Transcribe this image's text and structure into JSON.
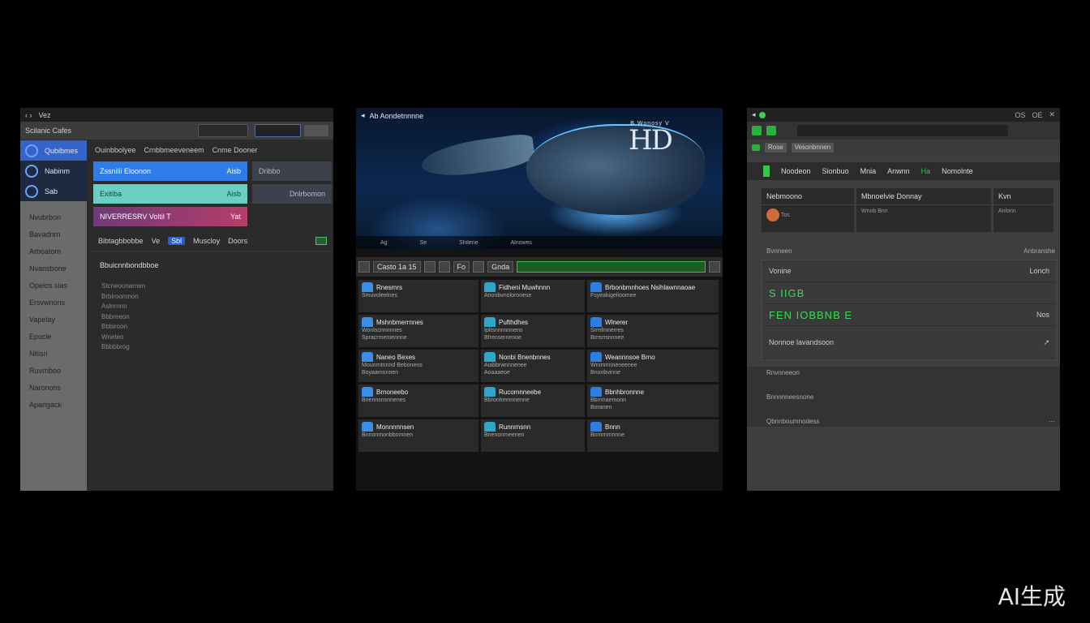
{
  "left": {
    "title": "Vez",
    "toolbar_label": "Scilanic Cafes",
    "side_top": [
      "Qubibmes",
      "Nabinm",
      "Sab"
    ],
    "side_list": [
      "Nvubrbon",
      "Bavadnrn",
      "Arboatom",
      "Nvansbone",
      "Opelos sias",
      "Ersvwnons",
      "Vapelay",
      "Epucle",
      "Nitisn",
      "Ruvrnboo",
      "Naronons",
      "Aparlgack"
    ],
    "tabs": [
      "Ouinbbolyee",
      "Crnbbmeeveneem",
      "Cnme Dooner"
    ],
    "cards": [
      {
        "label": "Zssnilii Eloonon",
        "tag": "Aisb"
      },
      {
        "label": "Dribbo",
        "tag": ""
      },
      {
        "label": "Exitiba",
        "tag": "Aisb"
      },
      {
        "label": "",
        "tag": "Dnlrbomon"
      },
      {
        "label": "NIVERRESRV  Voltil T",
        "tag": "Yat"
      }
    ],
    "subbar": [
      "Bibtagbbobbe",
      "Ve",
      "Sbl",
      "Muscloy",
      "Doors"
    ],
    "section_title": "Bbuicnnbondbboe",
    "bullets": [
      "Stcneoonarnen",
      "Brbiroomnon",
      "Aslnrnnn",
      "Bbbreeon",
      "Bbbiroon",
      "Wneten",
      "Bbbbbrog"
    ]
  },
  "mid": {
    "caption": "Ab  Aondetnnnne",
    "logo_small": "B Wonosy V",
    "logo_big": "HD",
    "bottom_caption": [
      "Ag",
      "Se",
      "Shilene",
      "Alnowes"
    ],
    "controls": [
      "Casto 1a 15",
      "Fo",
      "Gnda"
    ],
    "grid": [
      {
        "head": "Rnesmrs",
        "sub": [
          "Smuvoleelnes"
        ]
      },
      {
        "head": "Fidheni Muwhnnn",
        "sub": [
          "Anonbvnoloronese"
        ]
      },
      {
        "head": "Brbonbmnhoes Nsihlawnnaoae",
        "sub": [
          "Fsyeakigelioomee"
        ]
      },
      {
        "head": "Mshnbmerrnnes",
        "sub": [
          "Wonlscnnnnnes",
          "Spracrmemennne"
        ]
      },
      {
        "head": "Pufthdhes",
        "sub": [
          "Ipltsnnnnnnens",
          "Bfrensernenoe"
        ]
      },
      {
        "head": "Wlnerer",
        "sub": [
          "Srrnfmnerres",
          "Brnsnsnnnee"
        ]
      },
      {
        "head": "Naneo Bexes",
        "sub": [
          "Mounrntnnnd Bebonens",
          "Boyaamonnen"
        ]
      },
      {
        "head": "Nonbi Bnenbnnes",
        "sub": [
          "Aiabbrwnnnenee",
          "Aoaaaeoe"
        ]
      },
      {
        "head": "Weannnsoe Brno",
        "sub": [
          "Wnrnmnneneenee",
          "Bnonbvinne"
        ]
      },
      {
        "head": "Brnoneebo",
        "sub": [
          "Bnennsnsnnenes"
        ]
      },
      {
        "head": "Rucomnneebe",
        "sub": [
          "Bbronhmnnnenne"
        ]
      },
      {
        "head": "Bbnhbronnne",
        "sub": [
          "Bbrnnaemonn",
          "Boranen"
        ]
      },
      {
        "head": "Monnnnnsen",
        "sub": [
          "Bnnonmonbbomnen"
        ]
      },
      {
        "head": "Runnrnsnn",
        "sub": [
          "Bnenonmeenen"
        ]
      },
      {
        "head": "Bnnn",
        "sub": [
          "Bnmrnmnnne"
        ]
      }
    ]
  },
  "right": {
    "title_right": [
      "OS",
      "OE"
    ],
    "tabs": [
      "Rose",
      "Vesonbnnen"
    ],
    "nav": [
      "Noodeon",
      "Sionbuo",
      "Mnia",
      "Anwnn",
      "Ha",
      "Nomolnte"
    ],
    "cols": [
      {
        "h": "Nebmoono",
        "b": "Tos"
      },
      {
        "h": "Mbnoelvie  Donnay",
        "b": "Wnnb  Bnn"
      },
      {
        "h": "Kvn",
        "b": "Anlonn"
      }
    ],
    "section1": {
      "left": "Bvnneen",
      "right": "Anbranshe"
    },
    "rows": [
      {
        "left": "Vonine",
        "right": "Lonch"
      },
      {
        "left": "S IIGB",
        "right": "",
        "green": true
      },
      {
        "left": "FEN  IOBBNB E",
        "right": "Nos",
        "green": true
      },
      {
        "left": "Nonnoe lavandsoon",
        "right": ""
      }
    ],
    "section2": "Rnvnneeon",
    "lower_rows": [
      "Bnnnnneesnone",
      "Qbnnboumnodess"
    ]
  },
  "watermark": "AI生成"
}
